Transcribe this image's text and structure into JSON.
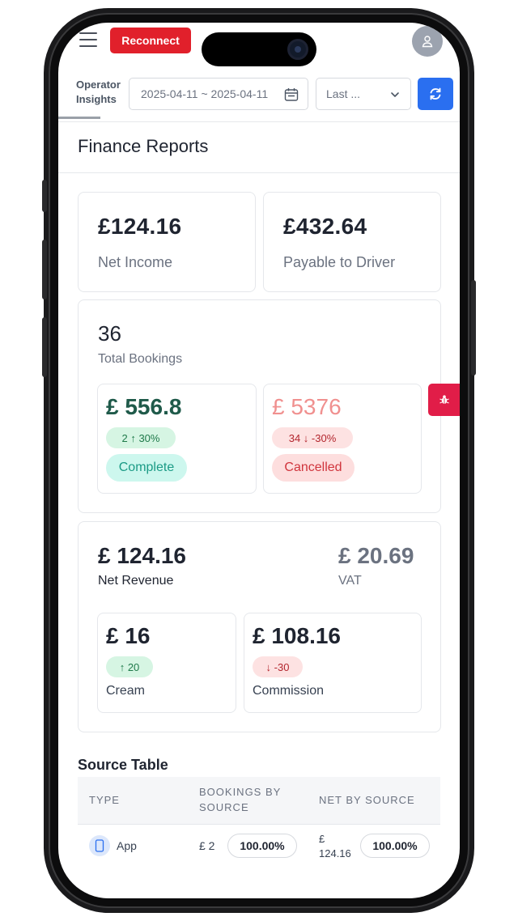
{
  "header": {
    "reconnect_label": "Reconnect",
    "operator_insights": "Operator Insights",
    "date_range": "2025-04-11 ~ 2025-04-11",
    "period_select": "Last ..."
  },
  "page": {
    "title": "Finance Reports"
  },
  "summary": {
    "net_income_value": "£124.16",
    "net_income_label": "Net Income",
    "payable_value": "£432.64",
    "payable_label": "Payable to Driver"
  },
  "bookings": {
    "total_value": "36",
    "total_label": "Total Bookings",
    "complete": {
      "amount": "£ 556.8",
      "delta": "2 ↑ 30%",
      "status": "Complete"
    },
    "cancelled": {
      "amount": "£ 5376",
      "delta": "34 ↓ -30%",
      "status": "Cancelled"
    }
  },
  "revenue": {
    "net_value": "£ 124.16",
    "net_label": "Net Revenue",
    "vat_value": "£ 20.69",
    "vat_label": "VAT",
    "cream": {
      "amount": "£ 16",
      "delta": "↑ 20",
      "label": "Cream"
    },
    "commission": {
      "amount": "£ 108.16",
      "delta": "↓ -30",
      "label": "Commission"
    }
  },
  "source_table": {
    "title": "Source Table",
    "headers": [
      "TYPE",
      "BOOKINGS BY SOURCE",
      "NET BY SOURCE"
    ],
    "rows": [
      {
        "type": "App",
        "bookings": "£ 2",
        "bookings_pct": "100.00%",
        "net": "£ 124.16",
        "net_pct": "100.00%"
      }
    ]
  },
  "colors": {
    "accent_blue": "#2a6ff0",
    "reconnect_red": "#e1202b",
    "complete_green": "#1f5a4a",
    "cancelled_salmon": "#f0908f",
    "side_tab": "#e11d48"
  },
  "icons": [
    "hamburger-icon",
    "user-icon",
    "calendar-icon",
    "chevron-down-icon",
    "refresh-icon",
    "bug-icon",
    "mobile-icon"
  ]
}
